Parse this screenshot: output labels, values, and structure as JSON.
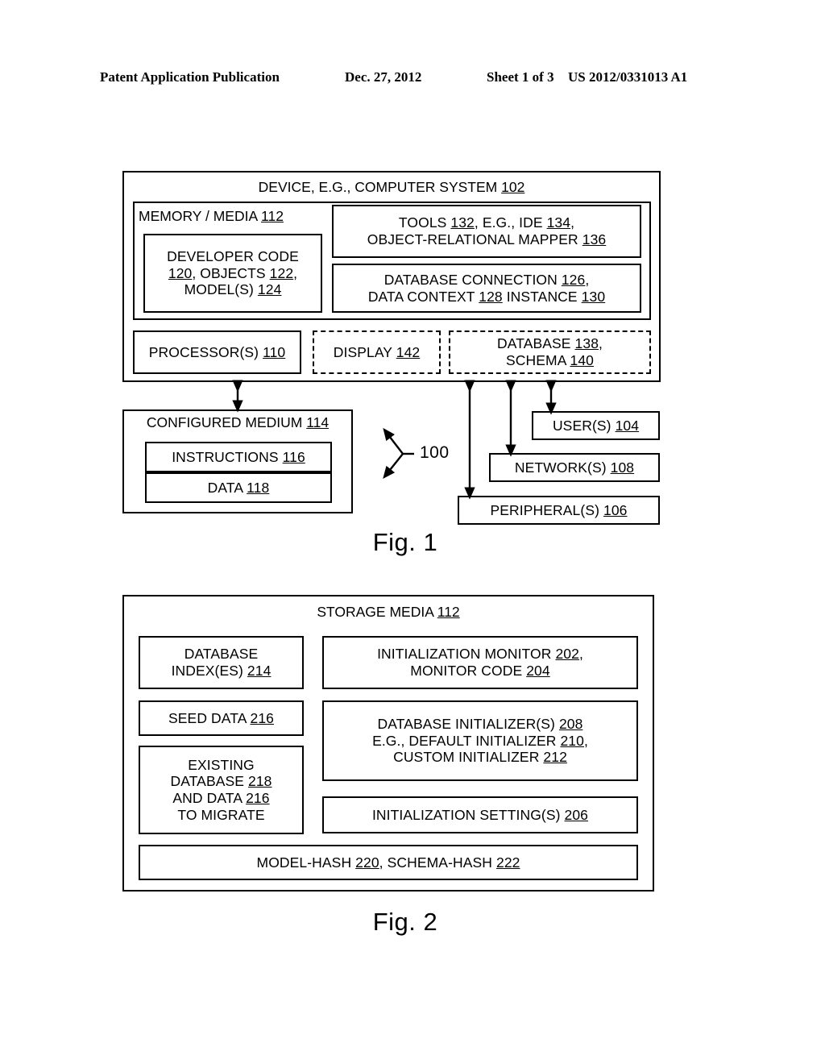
{
  "header": {
    "left": "Patent Application Publication",
    "date": "Dec. 27, 2012",
    "sheet": "Sheet 1 of 3",
    "right": "US 2012/0331013 A1"
  },
  "figure1": {
    "caption": "Fig. 1",
    "callout_number": "100",
    "device_box": {
      "title_text": "DEVICE, E.G., COMPUTER SYSTEM ",
      "title_ref": "102"
    },
    "memory_box": {
      "label_text": "MEMORY / MEDIA ",
      "label_ref": "112"
    },
    "developer_code_box": {
      "line1": "DEVELOPER CODE",
      "line2_ref_a": "120",
      "line2_mid": ", OBJECTS ",
      "line2_ref_b": "122",
      "line2_end": ",",
      "line3_text": "MODEL(S) ",
      "line3_ref": "124"
    },
    "tools_box": {
      "line1_a": "TOOLS ",
      "line1_ref_a": "132",
      "line1_b": ", E.G., IDE ",
      "line1_ref_b": "134",
      "line1_c": ",",
      "line2_a": "OBJECT-RELATIONAL MAPPER ",
      "line2_ref": "136"
    },
    "database_connection_box": {
      "line1_a": "DATABASE CONNECTION ",
      "line1_ref": "126",
      "line1_b": ",",
      "line2_a": "DATA CONTEXT ",
      "line2_ref_a": "128",
      "line2_b": " INSTANCE ",
      "line2_ref_b": "130"
    },
    "processor_box": {
      "text": "PROCESSOR(S) ",
      "ref": "110"
    },
    "display_box": {
      "text": "DISPLAY ",
      "ref": "142"
    },
    "database_schema_box": {
      "line1_a": "DATABASE ",
      "line1_ref": "138",
      "line1_b": ",",
      "line2_a": "SCHEMA ",
      "line2_ref": "140"
    },
    "configured_medium_box": {
      "text": "CONFIGURED MEDIUM ",
      "ref": "114"
    },
    "instructions_box": {
      "text": "INSTRUCTIONS ",
      "ref": "116"
    },
    "data_box": {
      "text": "DATA ",
      "ref": "118"
    },
    "users_box": {
      "text": "USER(S) ",
      "ref": "104"
    },
    "networks_box": {
      "text": "NETWORK(S) ",
      "ref": "108"
    },
    "peripherals_box": {
      "text": "PERIPHERAL(S) ",
      "ref": "106"
    }
  },
  "figure2": {
    "caption": "Fig. 2",
    "storage_media_box": {
      "title_text": "STORAGE MEDIA ",
      "title_ref": "112"
    },
    "database_indexes_box": {
      "line1": "DATABASE",
      "line2_text": "INDEX(ES) ",
      "line2_ref": "214"
    },
    "seed_data_box": {
      "text": "SEED DATA ",
      "ref": "216"
    },
    "existing_database_box": {
      "line1": "EXISTING",
      "line2_text": "DATABASE ",
      "line2_ref": "218",
      "line3_text": "AND DATA ",
      "line3_ref": "216",
      "line4": "TO MIGRATE"
    },
    "initialization_monitor_box": {
      "line1_a": "INITIALIZATION MONITOR ",
      "line1_ref": "202",
      "line1_b": ",",
      "line2_a": "MONITOR CODE ",
      "line2_ref": "204"
    },
    "database_initializers_box": {
      "line1_a": "DATABASE INITIALIZER(S) ",
      "line1_ref": "208",
      "line2_a": "E.G., DEFAULT INITIALIZER ",
      "line2_ref": "210",
      "line2_b": ",",
      "line3_a": "CUSTOM INITIALIZER ",
      "line3_ref": "212"
    },
    "initialization_settings_box": {
      "text": "INITIALIZATION SETTING(S) ",
      "ref": "206"
    },
    "hash_box": {
      "line1_a": "MODEL-HASH ",
      "line1_ref_a": "220",
      "line1_b": ", SCHEMA-HASH ",
      "line1_ref_b": "222"
    }
  }
}
